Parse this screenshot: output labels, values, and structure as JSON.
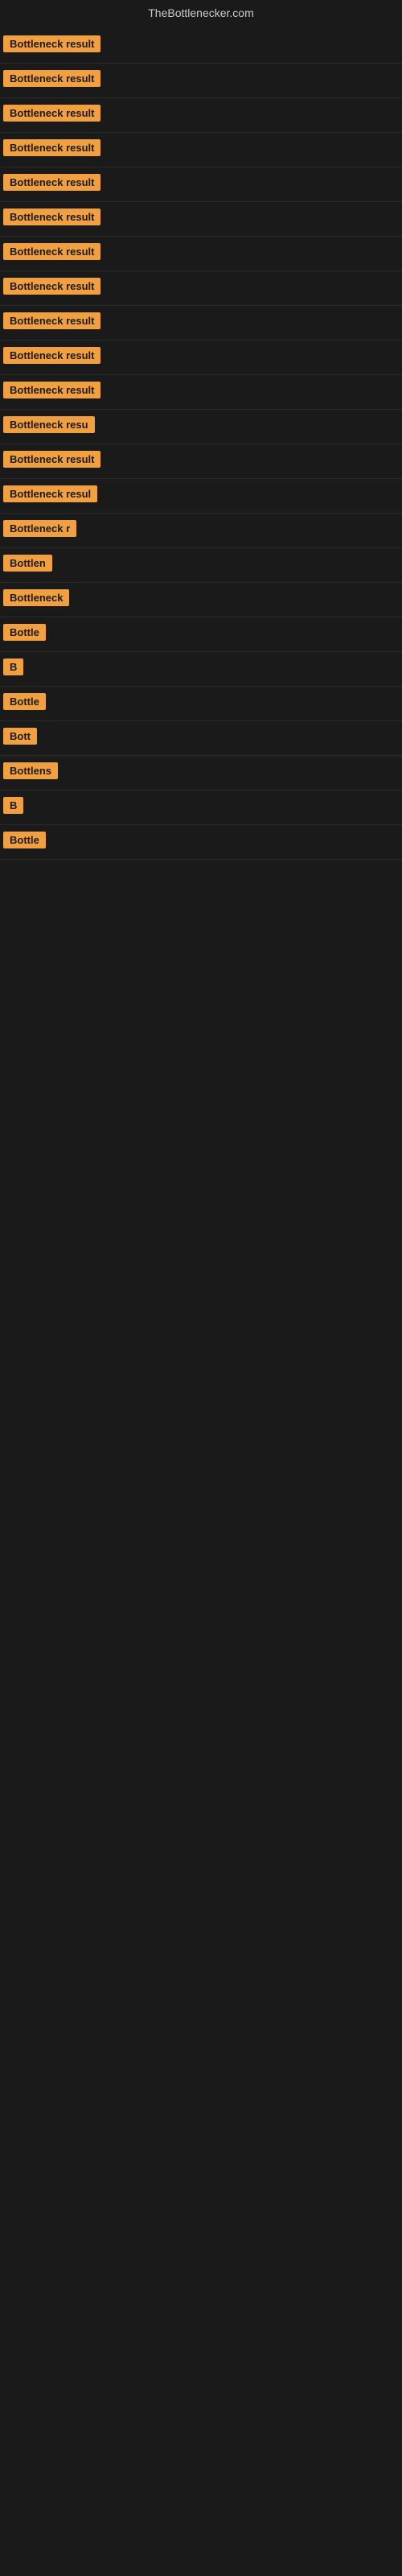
{
  "site": {
    "title": "TheBottlenecker.com"
  },
  "rows": [
    {
      "id": 1,
      "label": "Bottleneck result",
      "visible_text": "Bottleneck result"
    },
    {
      "id": 2,
      "label": "Bottleneck result",
      "visible_text": "Bottleneck result"
    },
    {
      "id": 3,
      "label": "Bottleneck result",
      "visible_text": "Bottleneck result"
    },
    {
      "id": 4,
      "label": "Bottleneck result",
      "visible_text": "Bottleneck result"
    },
    {
      "id": 5,
      "label": "Bottleneck result",
      "visible_text": "Bottleneck result"
    },
    {
      "id": 6,
      "label": "Bottleneck result",
      "visible_text": "Bottleneck result"
    },
    {
      "id": 7,
      "label": "Bottleneck result",
      "visible_text": "Bottleneck result"
    },
    {
      "id": 8,
      "label": "Bottleneck result",
      "visible_text": "Bottleneck result"
    },
    {
      "id": 9,
      "label": "Bottleneck result",
      "visible_text": "Bottleneck result"
    },
    {
      "id": 10,
      "label": "Bottleneck result",
      "visible_text": "Bottleneck result"
    },
    {
      "id": 11,
      "label": "Bottleneck result",
      "visible_text": "Bottleneck result"
    },
    {
      "id": 12,
      "label": "Bottleneck resu",
      "visible_text": "Bottleneck resu"
    },
    {
      "id": 13,
      "label": "Bottleneck result",
      "visible_text": "Bottleneck result"
    },
    {
      "id": 14,
      "label": "Bottleneck resul",
      "visible_text": "Bottleneck resul"
    },
    {
      "id": 15,
      "label": "Bottleneck r",
      "visible_text": "Bottleneck r"
    },
    {
      "id": 16,
      "label": "Bottlen",
      "visible_text": "Bottlen"
    },
    {
      "id": 17,
      "label": "Bottleneck",
      "visible_text": "Bottleneck"
    },
    {
      "id": 18,
      "label": "Bottle",
      "visible_text": "Bottle"
    },
    {
      "id": 19,
      "label": "B",
      "visible_text": "B"
    },
    {
      "id": 20,
      "label": "Bottle",
      "visible_text": "Bottle"
    },
    {
      "id": 21,
      "label": "Bott",
      "visible_text": "Bott"
    },
    {
      "id": 22,
      "label": "Bottlens",
      "visible_text": "Bottlens"
    },
    {
      "id": 23,
      "label": "B",
      "visible_text": "B"
    },
    {
      "id": 24,
      "label": "Bottle",
      "visible_text": "Bottle"
    }
  ]
}
